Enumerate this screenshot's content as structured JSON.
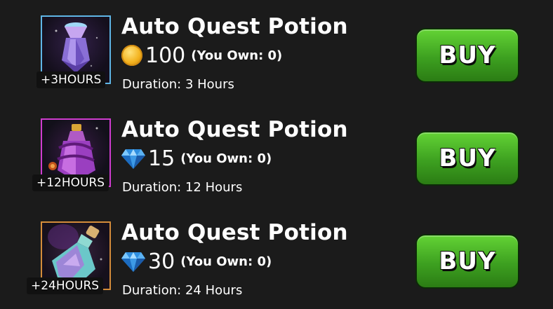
{
  "items": [
    {
      "title": "Auto Quest Potion",
      "currency": "coin",
      "currency_icon": "gold-coin-icon",
      "price": "100",
      "owned": "(You Own: 0)",
      "hours_badge": "+3HOURS",
      "duration": "Duration: 3 Hours",
      "buy_label": "BUY",
      "border_color": "#5fb6e6"
    },
    {
      "title": "Auto Quest Potion",
      "currency": "gem",
      "currency_icon": "blue-gem-icon",
      "price": "15",
      "owned": "(You Own: 0)",
      "hours_badge": "+12HOURS",
      "duration": "Duration: 12 Hours",
      "buy_label": "BUY",
      "border_color": "#cf3ccf"
    },
    {
      "title": "Auto Quest Potion",
      "currency": "gem",
      "currency_icon": "blue-gem-icon",
      "price": "30",
      "owned": "(You Own: 0)",
      "hours_badge": "+24HOURS",
      "duration": "Duration: 24 Hours",
      "buy_label": "BUY",
      "border_color": "#d48c3a"
    }
  ],
  "colors": {
    "background": "#1b1b1b",
    "buy_button": "#3da020"
  }
}
